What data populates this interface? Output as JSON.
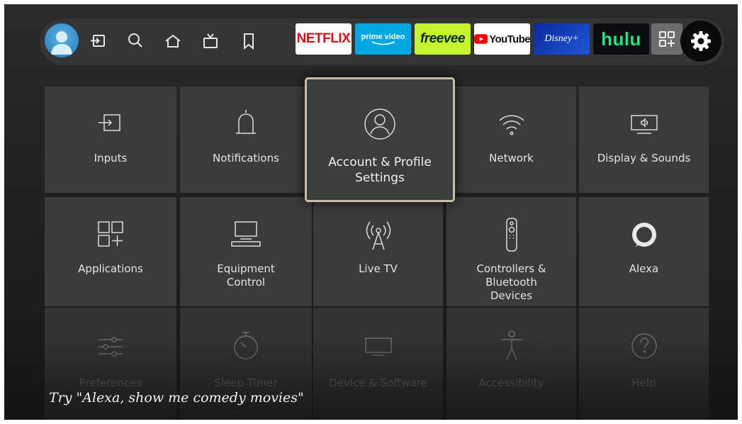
{
  "navbar": {
    "apps": [
      "NETFLIX",
      "prime video",
      "freevee",
      "YouTube",
      "Disney+",
      "hulu"
    ],
    "icons": [
      "profile-avatar",
      "inputs-icon",
      "search-icon",
      "home-icon",
      "live-tv-icon",
      "bookmark-icon",
      "app-library-icon",
      "settings-gear-icon"
    ]
  },
  "settings": {
    "tiles": [
      {
        "label": "Inputs",
        "icon": "inputs-icon"
      },
      {
        "label": "Notifications",
        "icon": "bell-icon"
      },
      {
        "label": "Account & Profile\nSettings",
        "icon": "profile-icon",
        "focused": true
      },
      {
        "label": "Network",
        "icon": "wifi-icon"
      },
      {
        "label": "Display & Sounds",
        "icon": "display-sound-icon"
      },
      {
        "label": "Applications",
        "icon": "apps-grid-icon"
      },
      {
        "label": "Equipment\nControl",
        "icon": "equipment-icon"
      },
      {
        "label": "Live TV",
        "icon": "antenna-icon"
      },
      {
        "label": "Controllers & Bluetooth\nDevices",
        "icon": "remote-icon"
      },
      {
        "label": "Alexa",
        "icon": "alexa-ring-icon"
      },
      {
        "label": "Preferences",
        "icon": "sliders-icon"
      },
      {
        "label": "Sleep Timer",
        "icon": "timer-icon"
      },
      {
        "label": "Device & Software",
        "icon": "tv-icon"
      },
      {
        "label": "Accessibility",
        "icon": "accessibility-icon"
      },
      {
        "label": "Help",
        "icon": "help-icon"
      }
    ]
  },
  "hint": "Try \"Alexa, show me comedy movies\"",
  "colors": {
    "netflix": "#e50914",
    "prime": "#00a8e1",
    "freevee": "#c5f52f",
    "youtube": "#ff0000",
    "disney": "#113ccf",
    "hulu": "#1ce783",
    "focus_border": "#c9bfa9"
  }
}
